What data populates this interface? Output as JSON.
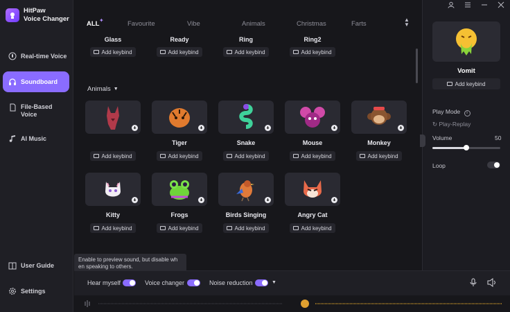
{
  "app": {
    "name_line1": "HitPaw",
    "name_line2": "Voice Changer"
  },
  "sidebar": {
    "items": [
      {
        "label": "Real-time Voice",
        "active": false
      },
      {
        "label": "Soundboard",
        "active": true
      },
      {
        "label": "File-Based",
        "label2": "Voice",
        "active": false
      },
      {
        "label": "AI Music",
        "active": false
      }
    ],
    "footer": [
      {
        "label": "User Guide"
      },
      {
        "label": "Settings"
      }
    ]
  },
  "tabs": [
    "ALL",
    "Favourite",
    "Vibe",
    "Animals",
    "Christmas",
    "Farts"
  ],
  "active_tab": "ALL",
  "prev_row": [
    "Glass",
    "Ready",
    "Ring",
    "Ring2"
  ],
  "keybind_label": "Add keybind",
  "section": {
    "title": "Animals"
  },
  "animals_row1": [
    "",
    "Tiger",
    "Snake",
    "Mouse",
    "Monkey"
  ],
  "animals_row2": [
    "Kitty",
    "Frogs",
    "Birds Singing",
    "Angry Cat"
  ],
  "right_panel": {
    "selected_name": "Vomit",
    "keybind": "Add keybind",
    "play_mode_label": "Play Mode",
    "play_mode_value": "Play-Replay",
    "volume_label": "Volume",
    "volume_value": "50",
    "volume_fraction": 0.5,
    "loop_label": "Loop",
    "loop_on": false
  },
  "bottom": {
    "hear_myself": "Hear myself",
    "voice_changer": "Voice changer",
    "noise_reduction": "Noise reduction",
    "tooltip_line1": "Enable to preview sound, but disable wh",
    "tooltip_line2": "en speaking to others."
  },
  "colors": {
    "accent": "#8a6cff",
    "bg": "#17171b",
    "panel": "#1f1f25"
  }
}
